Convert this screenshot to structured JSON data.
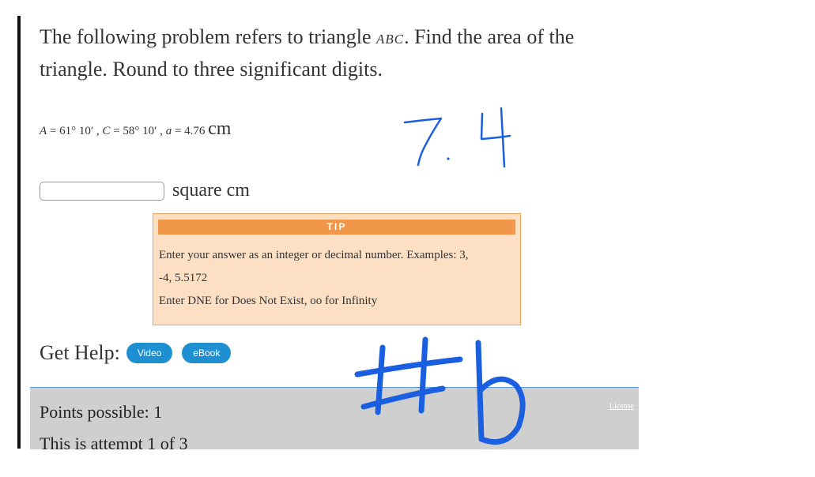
{
  "problem": {
    "text_before": "The following problem refers to triangle ",
    "triangle_name": "ABC",
    "text_after": ". Find the area of the triangle. Round to three significant digits."
  },
  "given": {
    "a_angle_label": "A",
    "a_angle_value": " = 61° 10′",
    "c_angle_label": "C",
    "c_angle_value": " = 58° 10′",
    "side_label": "a",
    "side_value": " = 4.76",
    "unit": "cm",
    "separator": " , "
  },
  "answer": {
    "value": "",
    "placeholder": "",
    "unit_label": "square cm"
  },
  "tip": {
    "header": "TIP",
    "line1": "Enter your answer as an integer or decimal number. Examples: 3,",
    "line2": "-4, 5.5172",
    "line3": "Enter DNE for Does Not Exist, oo for Infinity"
  },
  "help": {
    "label": "Get Help:",
    "video_label": "Video",
    "ebook_label": "eBook"
  },
  "footer": {
    "points": "Points possible: 1",
    "attempt": "This is attempt 1 of 3",
    "license": "License"
  },
  "handwriting": {
    "answer_note": "7.4",
    "problem_number": "#6",
    "ink_color": "#1a5fe0"
  }
}
